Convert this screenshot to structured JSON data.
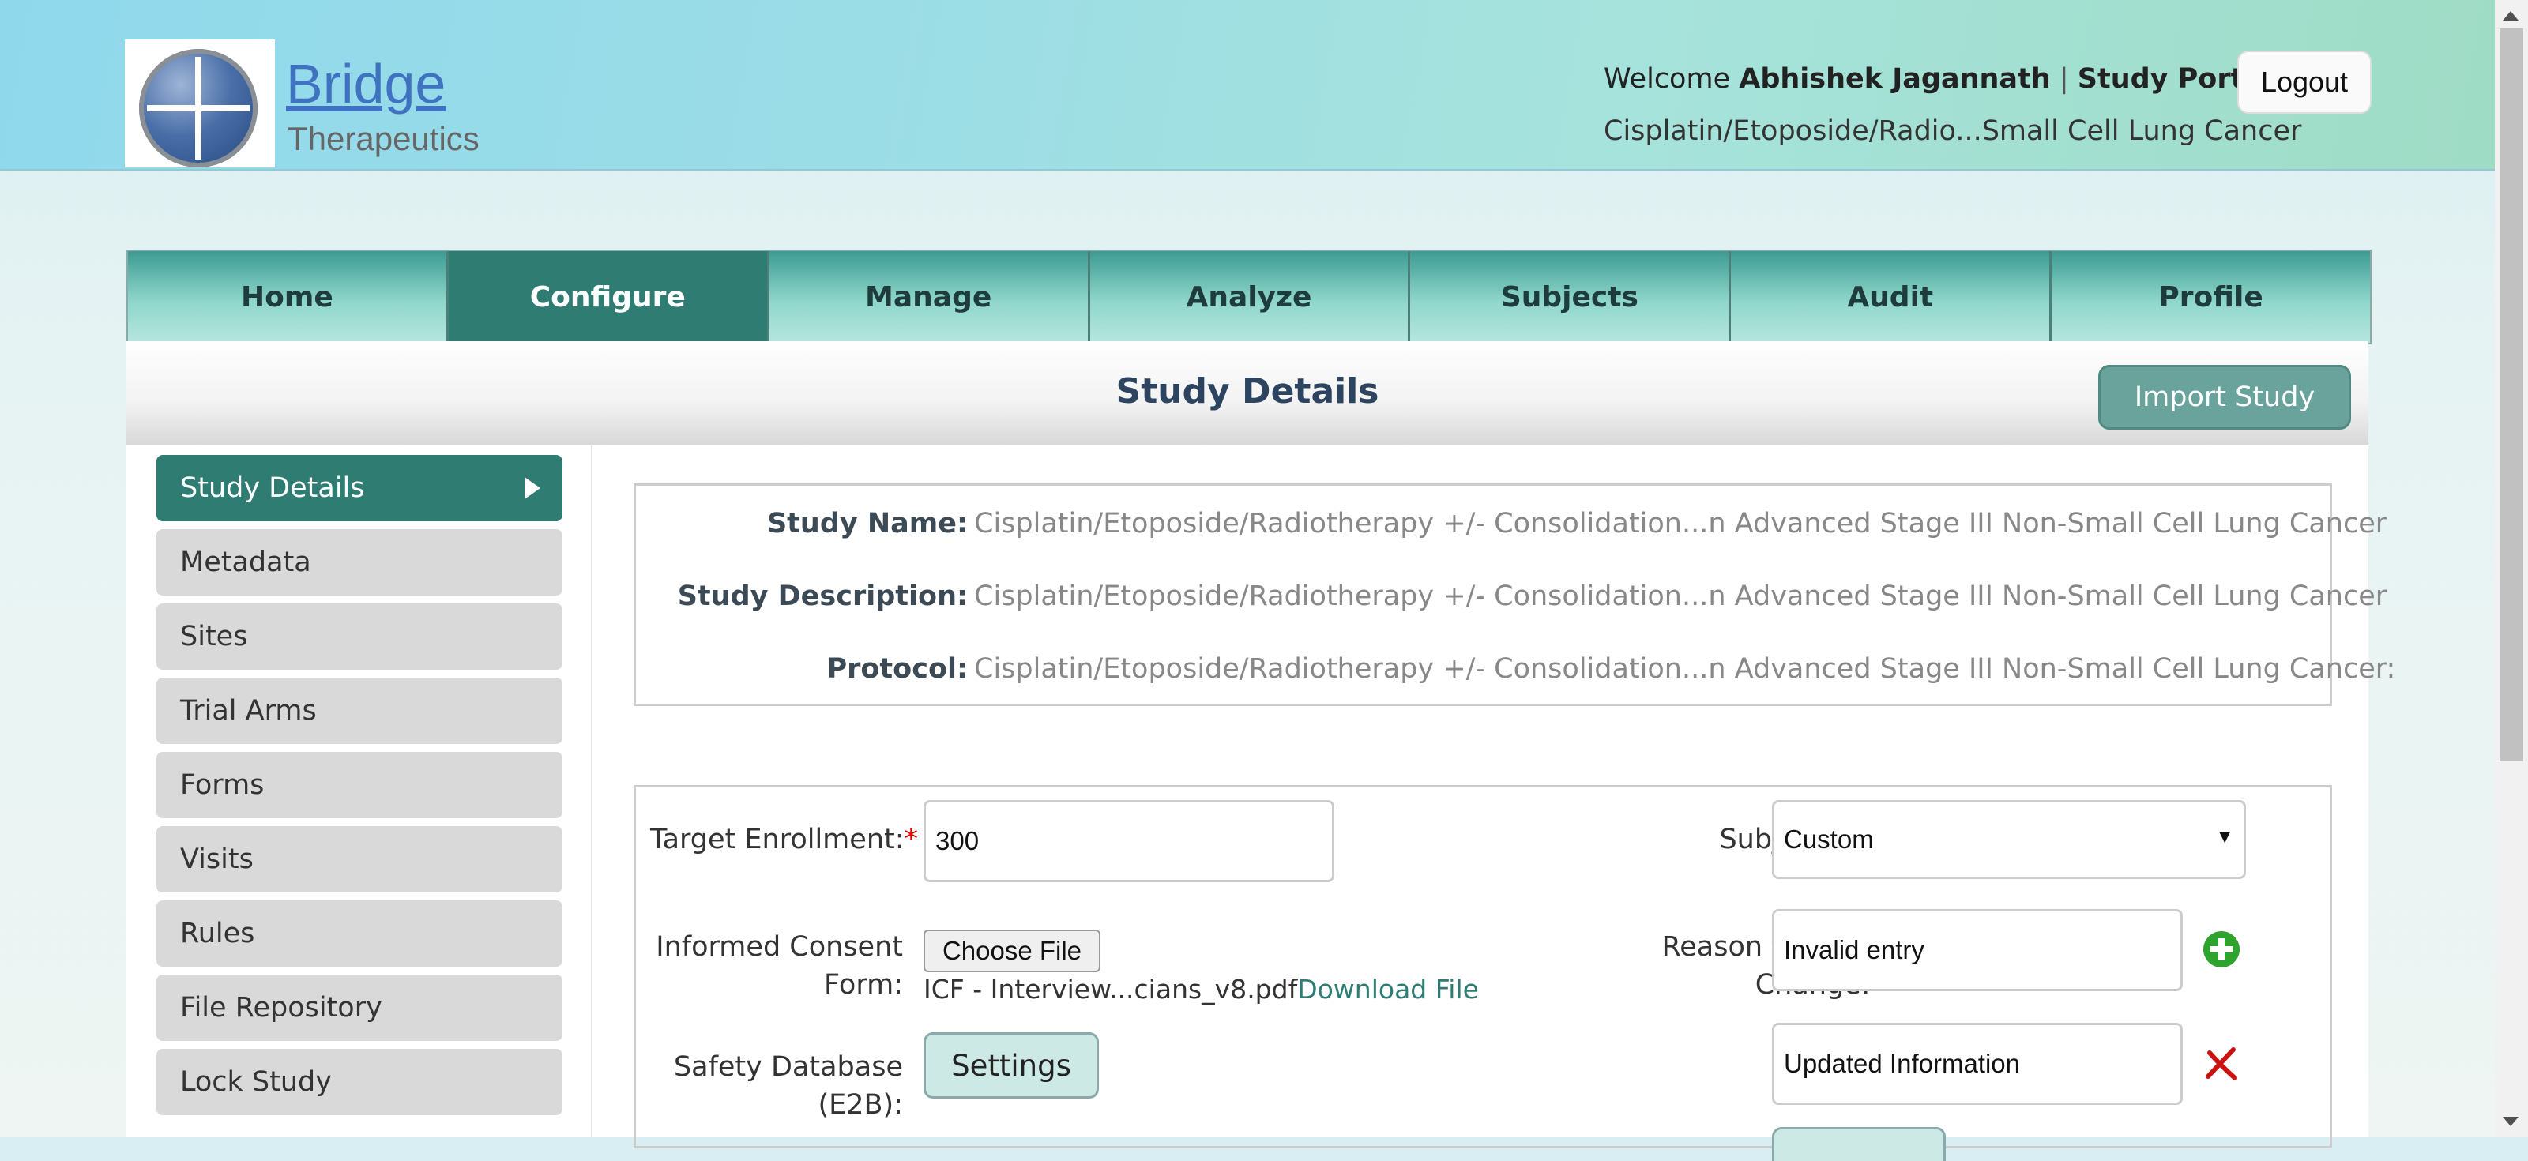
{
  "header": {
    "brand_name": "Bridge",
    "brand_tagline": "Therapeutics",
    "welcome_prefix": "Welcome",
    "user_name": "Abhishek Jagannath",
    "separator": "|",
    "portal_label": "Study Portal",
    "current_study": "Cisplatin/Etoposide/Radio...Small Cell Lung Cancer",
    "logout_label": "Logout"
  },
  "nav": {
    "tabs": [
      {
        "label": "Home"
      },
      {
        "label": "Configure",
        "active": true
      },
      {
        "label": "Manage"
      },
      {
        "label": "Analyze"
      },
      {
        "label": "Subjects"
      },
      {
        "label": "Audit"
      },
      {
        "label": "Profile"
      }
    ]
  },
  "page": {
    "title": "Study Details",
    "import_label": "Import Study"
  },
  "sidebar": {
    "items": [
      {
        "label": "Study Details",
        "active": true
      },
      {
        "label": "Metadata"
      },
      {
        "label": "Sites"
      },
      {
        "label": "Trial Arms"
      },
      {
        "label": "Forms"
      },
      {
        "label": "Visits"
      },
      {
        "label": "Rules"
      },
      {
        "label": "File Repository"
      },
      {
        "label": "Lock Study"
      }
    ]
  },
  "study_info": {
    "name_label": "Study Name:",
    "name_value": "Cisplatin/Etoposide/Radiotherapy +/- Consolidation...n Advanced Stage III Non-Small Cell Lung Cancer",
    "description_label": "Study Description:",
    "description_value": "Cisplatin/Etoposide/Radiotherapy +/- Consolidation...n Advanced Stage III Non-Small Cell Lung Cancer",
    "protocol_label": "Protocol:",
    "protocol_value": "Cisplatin/Etoposide/Radiotherapy +/- Consolidation...n Advanced Stage III Non-Small Cell Lung Cancer:"
  },
  "form": {
    "target_enrollment_label": "Target Enrollment:",
    "target_enrollment_value": "300",
    "required_mark": "*",
    "subject_id_label": "Subject ID:",
    "subject_id_value": "Custom",
    "consent_label_line1": "Informed Consent",
    "consent_label_line2": "Form:",
    "choose_file_label": "Choose File",
    "consent_file_name": "ICF - Interview...cians_v8.pdf",
    "download_label": "Download File",
    "reason_label_line1": "Reason for Data",
    "reason_label_line2": "Change:",
    "reason_values": [
      "Invalid entry",
      "Updated Information"
    ],
    "safety_label_line1": "Safety Database",
    "safety_label_line2": "(E2B):",
    "settings_label": "Settings"
  },
  "colors": {
    "accent": "#2e7c72",
    "tab_gradient_top": "#3d9b91",
    "title_text": "#2c4460",
    "required": "#dd0000",
    "add_icon": "#2ea42e",
    "remove_icon": "#cc1111"
  },
  "icons": {
    "active_arrow": "triangle-right-icon",
    "add_reason": "plus-circle-icon",
    "remove_reason": "x-mark-icon",
    "select_caret": "caret-down-icon"
  }
}
